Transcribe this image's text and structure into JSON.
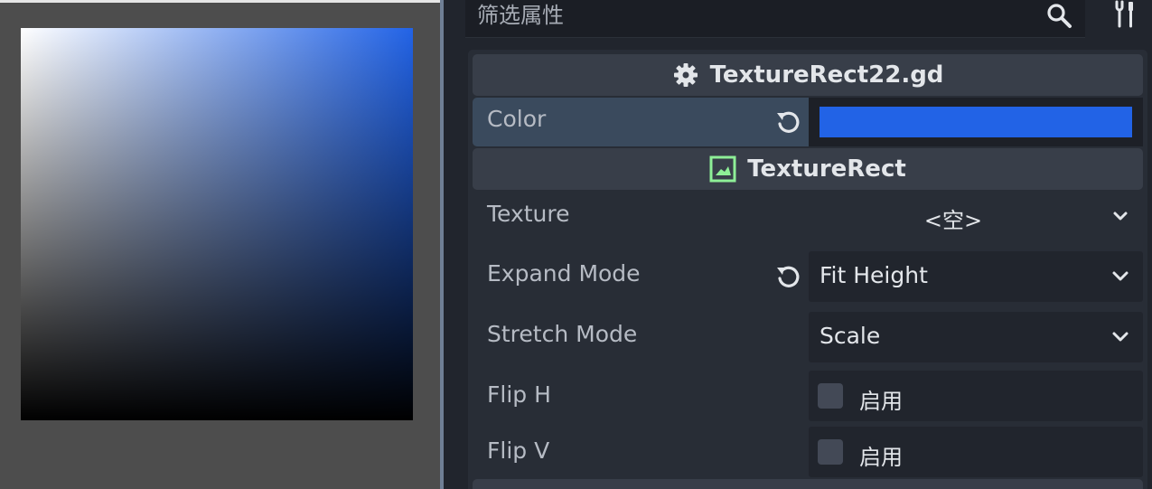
{
  "inspector": {
    "filter_placeholder": "筛选属性",
    "icons": {
      "search": "search-icon",
      "tools": "tools-icon"
    }
  },
  "script_section": {
    "title": "TextureRect22.gd",
    "icon": "gear-icon"
  },
  "color_property": {
    "label": "Color",
    "value": "#2263e6",
    "revert_icon": "revert-icon"
  },
  "texturerect_section": {
    "title": "TextureRect",
    "icon": "texturerect-icon"
  },
  "properties": {
    "texture": {
      "label": "Texture",
      "value": "<空>"
    },
    "expand_mode": {
      "label": "Expand Mode",
      "value": "Fit Height"
    },
    "stretch_mode": {
      "label": "Stretch Mode",
      "value": "Scale"
    },
    "flip_h": {
      "label": "Flip H",
      "checkbox_label": "启用",
      "checked": false
    },
    "flip_v": {
      "label": "Flip V",
      "checkbox_label": "启用",
      "checked": false
    }
  },
  "colors": {
    "accent_color": "#2263e6",
    "viewport_bg": "#4d4d4d",
    "inspector_bg": "#21252d",
    "section_header": "#383e49",
    "texturerect_icon": "#8eef97"
  }
}
